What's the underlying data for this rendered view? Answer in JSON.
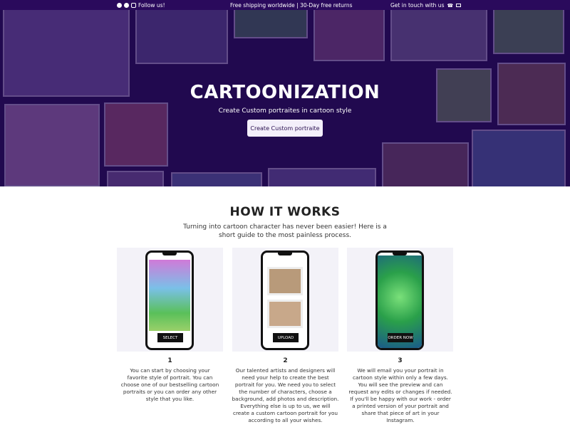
{
  "topbar": {
    "follow_label": "Follow us!",
    "shipping_text": "Free shipping worldwide | 30-Day free returns",
    "contact_label": "Get in touch with us",
    "social_icons": [
      "facebook-icon",
      "pinterest-icon",
      "instagram-icon"
    ],
    "contact_icons": [
      "phone-icon",
      "mail-icon"
    ]
  },
  "hero": {
    "title": "CARTOONIZATION",
    "subtitle": "Create Custom portraites in cartoon style",
    "cta_label": "Create Custom portraite"
  },
  "how_it_works": {
    "title": "HOW IT WORKS",
    "intro": "Turning into cartoon character has never been easier! Here is a short guide to the most painless process.",
    "steps": [
      {
        "number": "1",
        "button_label": "SELECT",
        "text": "You can start by choosing your favorite style of portrait. You can choose one of our bestselling cartoon portraits or you can order any other style that you like."
      },
      {
        "number": "2",
        "button_label": "UPLOAD",
        "text": "Our talented artists and designers will need your help to create the best portrait for you. We need you to select the number of characters, choose a background, add photos and description. Everything else is up to us, we will create a custom cartoon portrait for you according to all your wishes."
      },
      {
        "number": "3",
        "button_label": "ORDER NOW",
        "text": "We will email you your portrait in cartoon style within only a few days. You will see the preview and can request any edits or changes if needed. If you'll be happy with our work - order a printed version of your portrait and share that piece of art in your Instagram."
      }
    ]
  },
  "colors": {
    "topbar_bg": "#2a0a5c",
    "hero_bg": "#1f0a4a",
    "accent_button_bg": "#f3effa",
    "card_bg": "#f3f2f8"
  }
}
